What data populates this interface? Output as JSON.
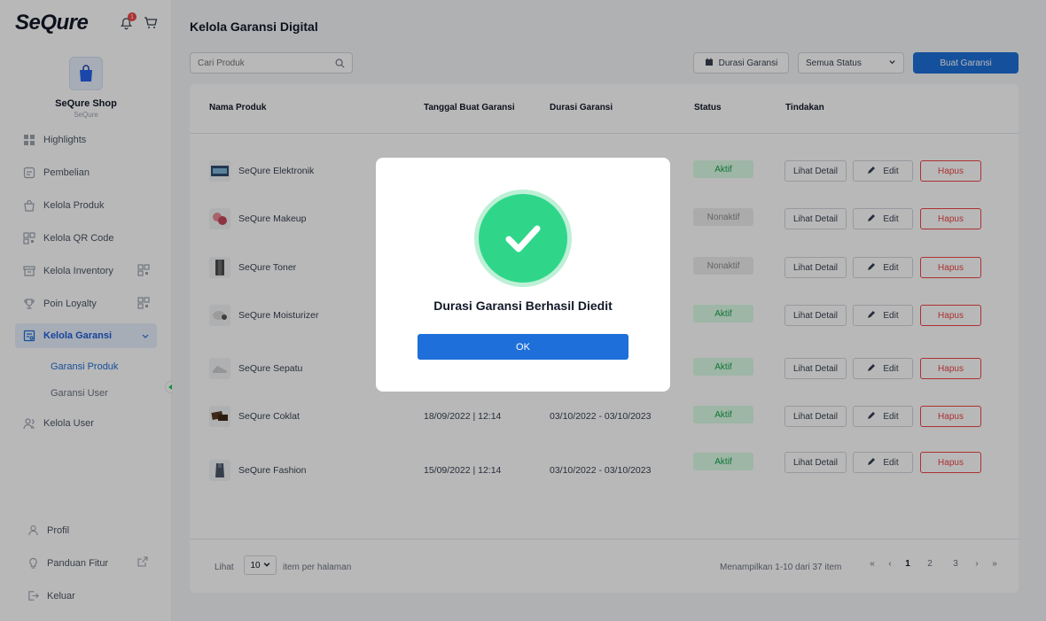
{
  "app": {
    "logo_text": "SeQure",
    "notification_count": "1"
  },
  "shop": {
    "name": "SeQure Shop",
    "subtitle": "SeQure"
  },
  "sidebar": {
    "items": [
      {
        "label": "Highlights",
        "icon": "grid-icon"
      },
      {
        "label": "Pembelian",
        "icon": "receipt-icon"
      },
      {
        "label": "Kelola Produk",
        "icon": "bag-icon"
      },
      {
        "label": "Kelola QR Code",
        "icon": "qr-icon"
      },
      {
        "label": "Kelola Inventory",
        "icon": "archive-icon"
      },
      {
        "label": "Poin Loyalty",
        "icon": "trophy-icon"
      },
      {
        "label": "Kelola Garansi",
        "icon": "warranty-icon"
      },
      {
        "label": "Kelola User",
        "icon": "users-icon"
      }
    ],
    "sub_items": [
      {
        "label": "Garansi Produk"
      },
      {
        "label": "Garansi User"
      }
    ],
    "bottom": [
      {
        "label": "Profil"
      },
      {
        "label": "Panduan Fitur"
      },
      {
        "label": "Keluar"
      }
    ]
  },
  "main": {
    "title": "Kelola Garansi Digital",
    "search_placeholder": "Cari Produk",
    "durasi_button": "Durasi Garansi",
    "status_select": "Semua Status",
    "create_button": "Buat Garansi"
  },
  "table": {
    "headers": [
      "Nama Produk",
      "Tanggal Buat Garansi",
      "Durasi Garansi",
      "Status",
      "Tindakan"
    ],
    "rows": [
      {
        "name": "SeQure Elektronik",
        "created": "",
        "duration": "",
        "status": "Aktif"
      },
      {
        "name": "SeQure Makeup",
        "created": "",
        "duration": "",
        "status": "Nonaktif"
      },
      {
        "name": "SeQure Toner",
        "created": "",
        "duration": "",
        "status": "Nonaktif"
      },
      {
        "name": "SeQure Moisturizer",
        "created": "",
        "duration": "",
        "status": "Aktif"
      },
      {
        "name": "SeQure Sepatu",
        "created": "",
        "duration": "",
        "status": "Aktif"
      },
      {
        "name": "SeQure Coklat",
        "created": "18/09/2022 | 12:14",
        "duration": "03/10/2022 - 03/10/2023",
        "status": "Aktif"
      },
      {
        "name": "SeQure Fashion",
        "created": "15/09/2022 | 12:14",
        "duration": "03/10/2022 - 03/10/2023",
        "status": "Aktif"
      }
    ],
    "actions": {
      "detail": "Lihat Detail",
      "edit": "Edit",
      "delete": "Hapus"
    }
  },
  "footer": {
    "show_label": "Lihat",
    "per_page": "10",
    "per_page_label": "item per halaman",
    "range_text": "Menampilkan 1-10 dari 37 item",
    "pages": [
      "«",
      "‹",
      "1",
      "2",
      "3",
      "›",
      "»"
    ],
    "current_page": "1"
  },
  "modal": {
    "title": "Durasi Garansi Berhasil Diedit",
    "ok_label": "OK"
  },
  "colors": {
    "primary": "#1e6fd9",
    "success": "#2fd68a",
    "danger": "#ef4444"
  }
}
